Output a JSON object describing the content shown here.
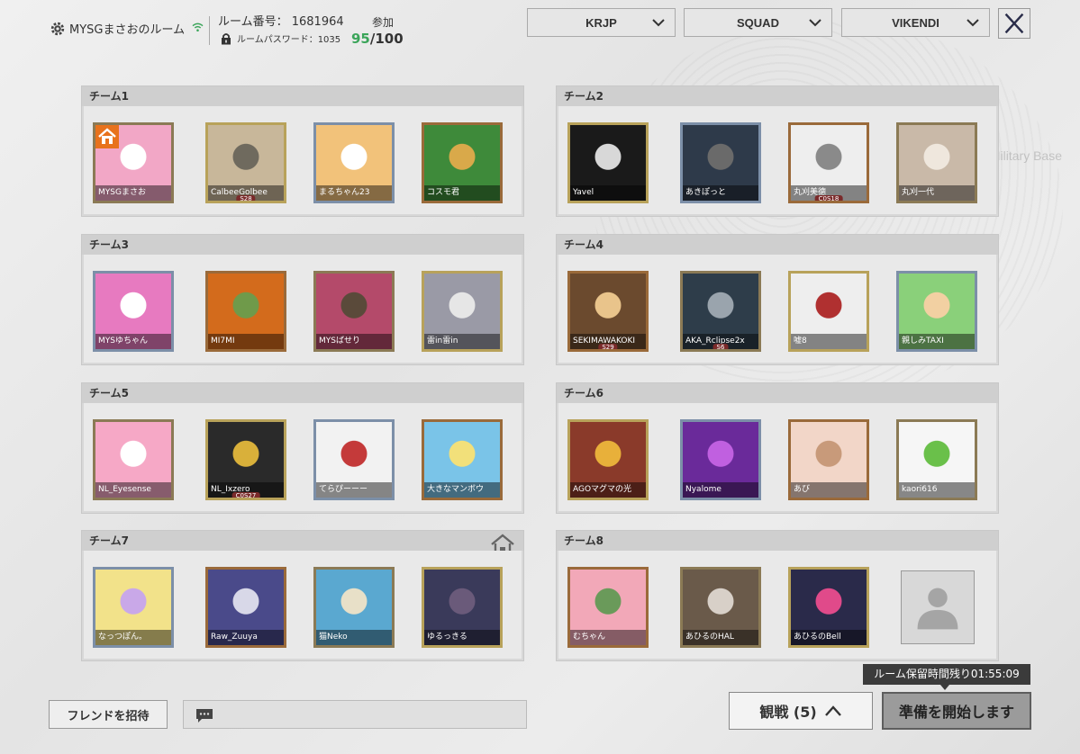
{
  "header": {
    "room_name": "MYSGまさおのルーム",
    "room_number": "ルーム番号： 1681964",
    "room_password": "ルームパスワード：1035",
    "join_label": "参加",
    "join_current": "95",
    "join_separator": "/",
    "join_max": "100",
    "icons": {
      "settings": "gear-icon",
      "signal": "wifi-icon",
      "password": "lock-icon",
      "close": "close-icon"
    }
  },
  "filters": {
    "region": "KRJP",
    "mode": "SQUAD",
    "map": "VIKENDI"
  },
  "background_text": "Military Base",
  "teams": [
    {
      "name": "チーム1",
      "members": [
        {
          "name": "MYSGまさお",
          "host": true,
          "colors": [
            "#f2a7c6",
            "#ffffff"
          ]
        },
        {
          "name": "CalbeeGolbee",
          "badge": "S28",
          "colors": [
            "#c8b79a",
            "#6f6a5e"
          ]
        },
        {
          "name": "まるちゃん23",
          "colors": [
            "#f2c27a",
            "#ffffff"
          ]
        },
        {
          "name": "コスモ君",
          "colors": [
            "#3e8a3a",
            "#d9a94a"
          ]
        }
      ]
    },
    {
      "name": "チーム2",
      "members": [
        {
          "name": "Yavel",
          "colors": [
            "#1a1a1a",
            "#d8d8d8"
          ]
        },
        {
          "name": "あきぽっと",
          "colors": [
            "#2e3a4a",
            "#6a6a6a"
          ]
        },
        {
          "name": "丸刈美德",
          "badge": "C0S18",
          "colors": [
            "#eeeeee",
            "#8a8a8a"
          ]
        },
        {
          "name": "丸刈一代",
          "colors": [
            "#c9b9a8",
            "#efe7dd"
          ]
        }
      ]
    },
    {
      "name": "チーム3",
      "members": [
        {
          "name": "MYSゆちゃん",
          "colors": [
            "#e77ac0",
            "#ffffff"
          ]
        },
        {
          "name": "MI7MI",
          "colors": [
            "#d36b1c",
            "#6f9a4a"
          ]
        },
        {
          "name": "MYSばせり",
          "colors": [
            "#b44a6a",
            "#5a4a3a"
          ]
        },
        {
          "name": "雷in雷in",
          "colors": [
            "#9a9aa6",
            "#e6e6e6"
          ]
        }
      ]
    },
    {
      "name": "チーム4",
      "members": [
        {
          "name": "SEKIMAWAKOKI",
          "badge": "S29",
          "colors": [
            "#6b4a2e",
            "#e9c48b"
          ]
        },
        {
          "name": "AKA_Rclipse2x",
          "badge": "S6",
          "colors": [
            "#2e3d4a",
            "#9aa4ad"
          ]
        },
        {
          "name": "嘘8",
          "colors": [
            "#eeeeee",
            "#b03030"
          ]
        },
        {
          "name": "親しみTAXI",
          "colors": [
            "#8ad07a",
            "#f2d0a2"
          ]
        }
      ]
    },
    {
      "name": "チーム5",
      "members": [
        {
          "name": "NL_Eyesense",
          "colors": [
            "#f6a8c6",
            "#ffffff"
          ]
        },
        {
          "name": "NL_Ixzero",
          "badge": "C0S27",
          "colors": [
            "#2a2a2a",
            "#d9b03a"
          ]
        },
        {
          "name": "てらぴーーー",
          "colors": [
            "#f2f2f2",
            "#c43a3a"
          ]
        },
        {
          "name": "大きなマンボウ",
          "colors": [
            "#7ac4e8",
            "#f2e07a"
          ]
        }
      ]
    },
    {
      "name": "チーム6",
      "members": [
        {
          "name": "AGOマグマの光",
          "colors": [
            "#8a3a2a",
            "#e8b03a"
          ]
        },
        {
          "name": "Nyalome",
          "colors": [
            "#6a2a9a",
            "#c060e0"
          ]
        },
        {
          "name": "あび",
          "colors": [
            "#f2d6c8",
            "#c89a7a"
          ]
        },
        {
          "name": "kaori616",
          "colors": [
            "#f6f6f6",
            "#6ac04a"
          ]
        }
      ]
    },
    {
      "name": "チーム7",
      "members": [
        {
          "name": "なっつぽん。",
          "colors": [
            "#f2e28a",
            "#c9a8e8"
          ]
        },
        {
          "name": "Raw_Zuuya",
          "colors": [
            "#4a4a8a",
            "#d8d8e8"
          ]
        },
        {
          "name": "猫Neko",
          "colors": [
            "#5aa8d0",
            "#e8e0c8"
          ]
        },
        {
          "name": "ゆるっきる",
          "colors": [
            "#3a3a5a",
            "#6a5a7a"
          ]
        }
      ]
    },
    {
      "name": "チーム8",
      "members": [
        {
          "name": "むちゃん",
          "colors": [
            "#f2a8b8",
            "#6a9a5a"
          ]
        },
        {
          "name": "あひるのHAL",
          "colors": [
            "#6a5a4a",
            "#d8d0c8"
          ]
        },
        {
          "name": "あひるのBell",
          "colors": [
            "#2a2a4a",
            "#e04a8a"
          ]
        }
      ]
    }
  ],
  "footer": {
    "invite_label": "フレンドを招待",
    "chat_icon": "chat-icon",
    "watch_label": "観戦 (5)",
    "watch_icon": "chevron-up-icon",
    "ready_label": "準備を開始します",
    "timer_label": "ルーム保留時間残り01:55:09"
  }
}
